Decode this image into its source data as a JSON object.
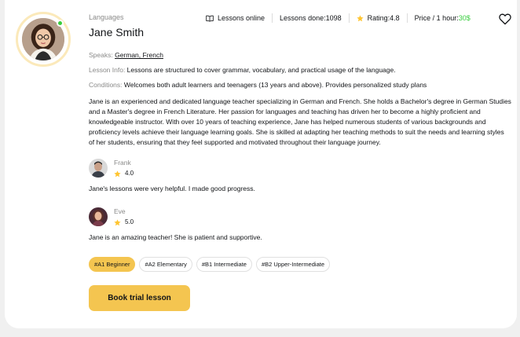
{
  "teacher": {
    "category_label": "Languages",
    "name": "Jane Smith",
    "online": true
  },
  "stats": {
    "lessons_online": "Lessons online",
    "lessons_done_label": "Lessons done: ",
    "lessons_done": "1098",
    "rating_label": "Rating: ",
    "rating": "4.8",
    "price_label": "Price / 1 hour: ",
    "price": "30$"
  },
  "info": {
    "speaks_label": "Speaks: ",
    "speaks_value": "German, French",
    "lesson_info_label": "Lesson Info: ",
    "lesson_info_value": "Lessons are structured to cover grammar, vocabulary, and practical usage of the language.",
    "conditions_label": "Conditions: ",
    "conditions_value": "Welcomes both adult learners and teenagers (13 years and above). Provides personalized study plans"
  },
  "description": "Jane is an experienced and dedicated language teacher specializing in German and French. She holds a Bachelor's degree in German Studies and a Master's degree in French Literature. Her passion for languages and teaching has driven her to become a highly proficient and knowledgeable instructor. With over 10 years of teaching experience, Jane has helped numerous students of various backgrounds and proficiency levels achieve their language learning goals. She is skilled at adapting her teaching methods to suit the needs and learning styles of her students, ensuring that they feel supported and motivated throughout their language journey.",
  "reviews": [
    {
      "name": "Frank",
      "rating": "4.0",
      "comment": "Jane's lessons were very helpful. I made good progress."
    },
    {
      "name": "Eve",
      "rating": "5.0",
      "comment": "Jane is an amazing teacher! She is patient and supportive."
    }
  ],
  "levels": [
    {
      "label": "#A1 Beginner",
      "active": true
    },
    {
      "label": "#A2 Elementary",
      "active": false
    },
    {
      "label": "#B1 Intermediate",
      "active": false
    },
    {
      "label": "#B2 Upper-Intermediate",
      "active": false
    }
  ],
  "actions": {
    "book_trial": "Book trial lesson"
  },
  "colors": {
    "accent": "#f4c550",
    "online": "#38cd3e",
    "muted_text": "#8a8a89",
    "avatar_ring": "#fbe9ba"
  },
  "icons": {
    "lessons": "book-open-icon",
    "rating": "star-icon",
    "favorite": "heart-icon"
  }
}
